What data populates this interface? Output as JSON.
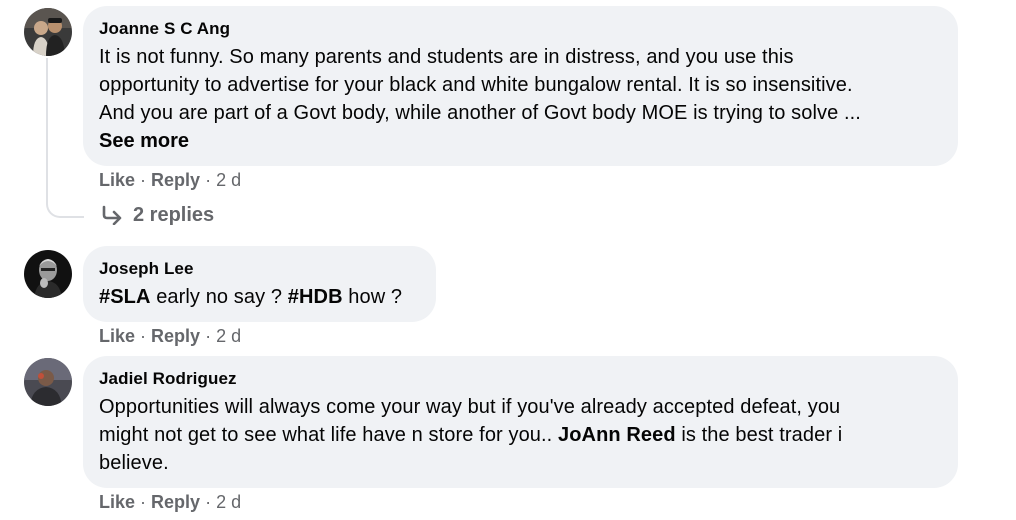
{
  "comments": [
    {
      "author": "Joanne S C Ang",
      "text_lines": [
        "It is not funny. So many parents and students are in distress, and you use this",
        "opportunity to advertise for your black and white bungalow rental. It is so insensitive.",
        "And you are part of a Govt body, while another of Govt body MOE is trying to solve ..."
      ],
      "see_more": "See more",
      "actions": {
        "like": "Like",
        "reply": "Reply",
        "time": "2 d"
      },
      "replies_label": "2 replies"
    },
    {
      "author": "Joseph Lee",
      "text_parts": {
        "tag1": "#SLA",
        "mid": " early no say ? ",
        "tag2": "#HDB",
        "end": " how ?"
      },
      "actions": {
        "like": "Like",
        "reply": "Reply",
        "time": "2 d"
      }
    },
    {
      "author": "Jadiel Rodriguez",
      "text_lines": [
        "Opportunities will always come your way but if you've already accepted defeat, you"
      ],
      "line2_start": "might not get to see what life have n store for you.. ",
      "line2_mention": "JoAnn Reed",
      "line2_end": " is the best trader i",
      "line3": "believe.",
      "actions": {
        "like": "Like",
        "reply": "Reply",
        "time": "2 d"
      }
    }
  ],
  "separator": "·",
  "colors": {
    "bubble": "#f0f2f5",
    "meta_text": "#65676b",
    "text": "#050505"
  },
  "icons": {
    "reply_arrow": "reply-arrow-icon"
  }
}
